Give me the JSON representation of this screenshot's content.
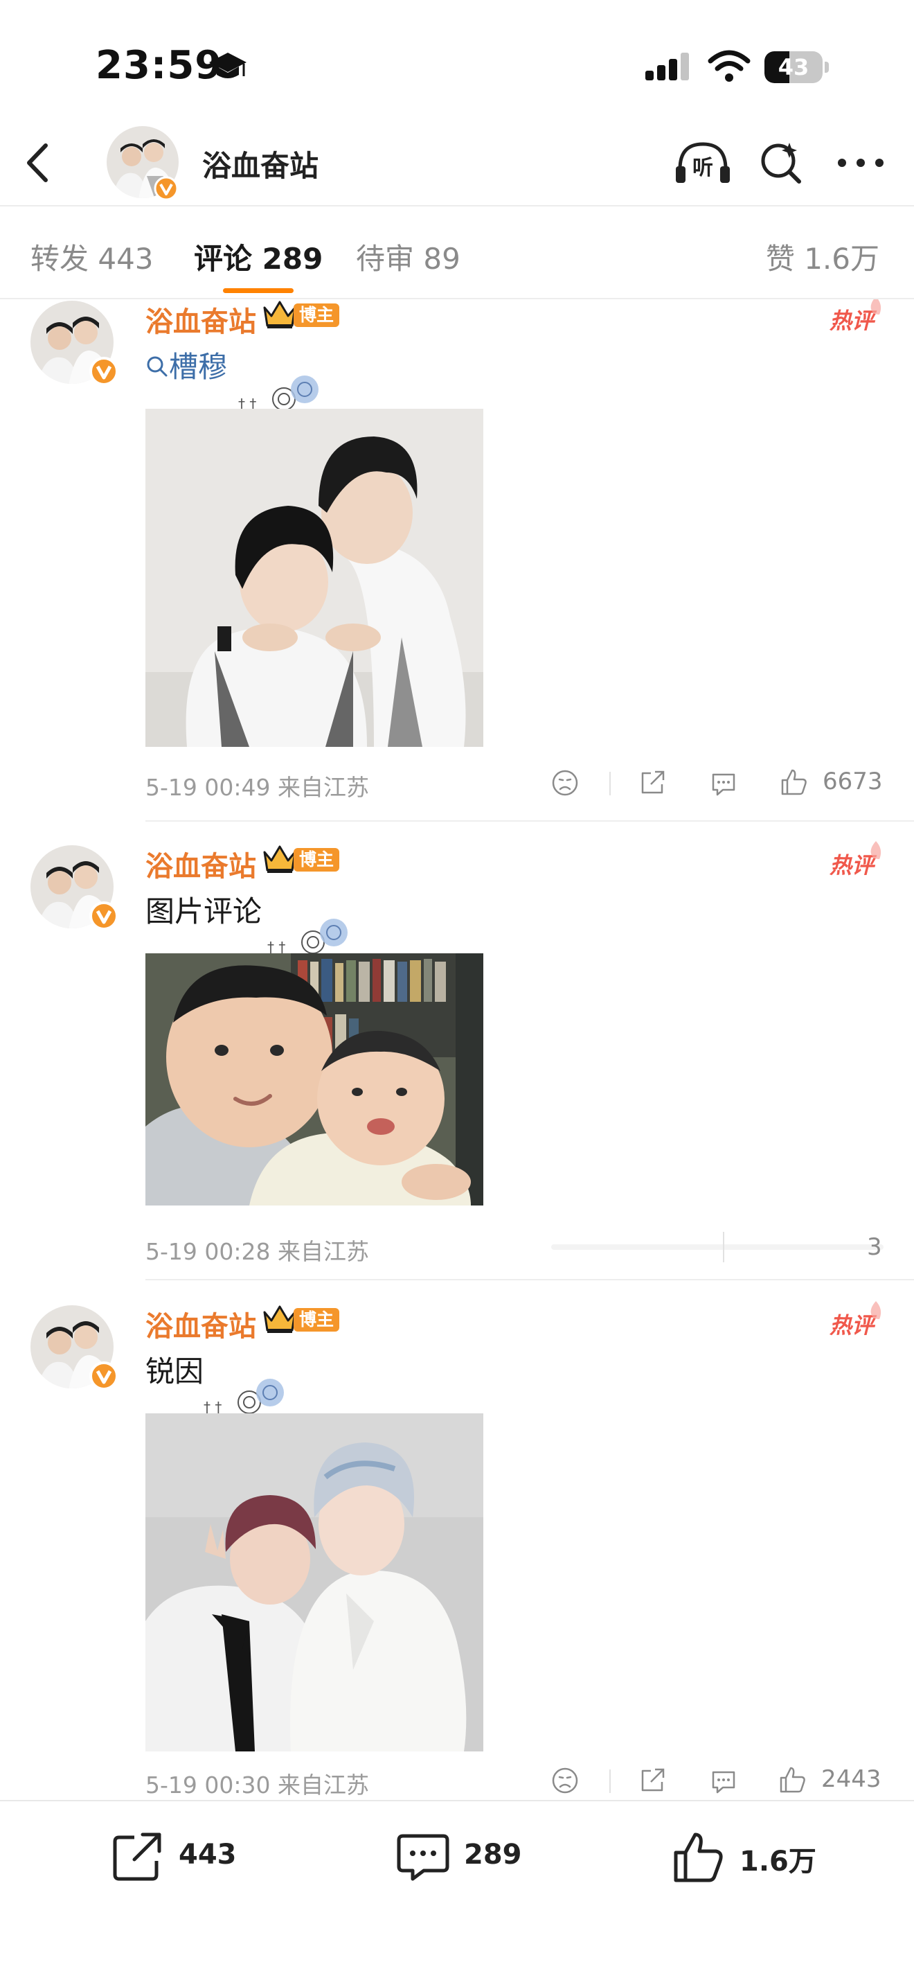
{
  "status_bar": {
    "time": "23:59",
    "battery": "43",
    "battery_level": 0.43,
    "icons": [
      "graduation-cap-icon",
      "signal-icon",
      "wifi-icon",
      "battery-icon"
    ]
  },
  "header": {
    "title": "浴血奋站",
    "icons": [
      "back-icon",
      "verified-badge-icon",
      "listen-icon",
      "search-icon",
      "more-icon"
    ],
    "listen_glyph": "听"
  },
  "tabs": {
    "repost": "转发 443",
    "comments_label": "评论",
    "comments_count": "289",
    "pending": "待审 89",
    "likes": "赞 1.6万"
  },
  "comments": [
    {
      "name": "浴血奋站",
      "badge": "博主",
      "hot_tag": "热评",
      "text": "槽穆",
      "text_kind": "search-keyword",
      "time": "5-19 00:49",
      "location": "来自江苏",
      "likes": "6673"
    },
    {
      "name": "浴血奋站",
      "badge": "博主",
      "hot_tag": "热评",
      "text": "图片评论",
      "time": "5-19 00:28",
      "location": "来自江苏",
      "likes": "3"
    },
    {
      "name": "浴血奋站",
      "badge": "博主",
      "hot_tag": "热评",
      "text": "锐因",
      "time": "5-19 00:30",
      "location": "来自江苏",
      "likes": "2443"
    }
  ],
  "bottom_bar": {
    "reposts": "443",
    "comments": "289",
    "likes": "1.6万"
  },
  "colors": {
    "accent": "#ff8200",
    "username": "#ea7a2d",
    "badge": "#f5962a",
    "hot": "#f0584b",
    "muted": "#9b9b9b"
  }
}
